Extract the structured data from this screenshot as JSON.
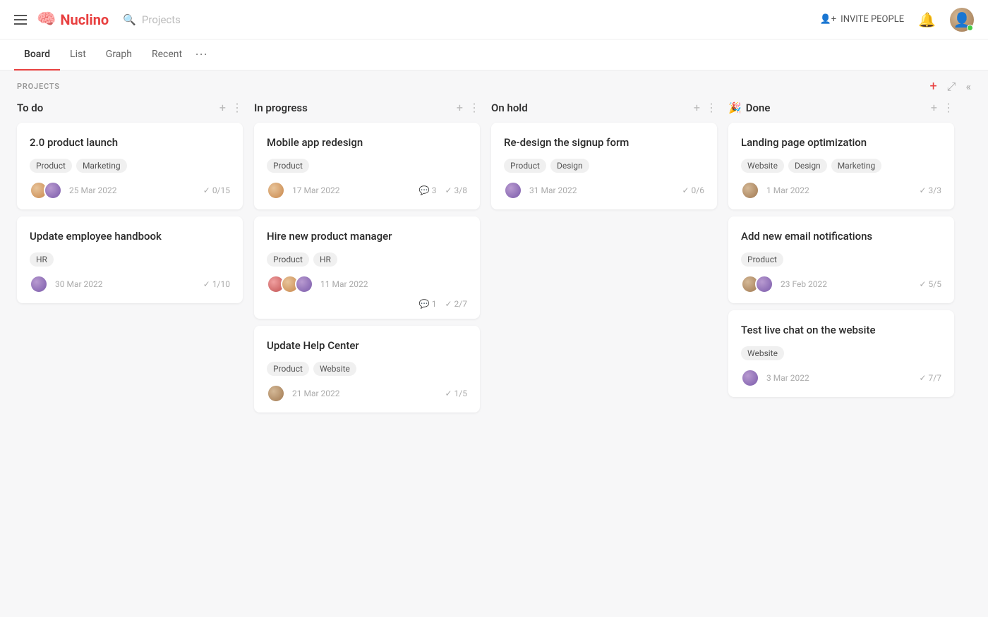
{
  "app": {
    "name": "Nuclino",
    "search_placeholder": "Projects"
  },
  "nav": {
    "invite_label": "INVITE PEOPLE",
    "tabs": [
      {
        "id": "board",
        "label": "Board",
        "active": true
      },
      {
        "id": "list",
        "label": "List",
        "active": false
      },
      {
        "id": "graph",
        "label": "Graph",
        "active": false
      },
      {
        "id": "recent",
        "label": "Recent",
        "active": false
      }
    ]
  },
  "board": {
    "section_label": "PROJECTS",
    "columns": [
      {
        "id": "todo",
        "title": "To do",
        "emoji": "",
        "cards": [
          {
            "id": "product-launch",
            "title": "2.0 product launch",
            "tags": [
              "Product",
              "Marketing"
            ],
            "date": "25 Mar 2022",
            "check": "0/15",
            "avatars": [
              "orange",
              "purple"
            ]
          },
          {
            "id": "employee-handbook",
            "title": "Update employee handbook",
            "tags": [
              "HR"
            ],
            "date": "30 Mar 2022",
            "check": "1/10",
            "avatars": [
              "purple"
            ]
          }
        ]
      },
      {
        "id": "in-progress",
        "title": "In progress",
        "emoji": "",
        "cards": [
          {
            "id": "mobile-redesign",
            "title": "Mobile app redesign",
            "tags": [
              "Product"
            ],
            "date": "17 Mar 2022",
            "comments": "3",
            "check": "3/8",
            "avatars": [
              "orange"
            ]
          },
          {
            "id": "hire-manager",
            "title": "Hire new product manager",
            "tags": [
              "Product",
              "HR"
            ],
            "date": "11 Mar 2022",
            "comments": "1",
            "check": "2/7",
            "avatars": [
              "red",
              "orange",
              "purple"
            ]
          },
          {
            "id": "help-center",
            "title": "Update Help Center",
            "tags": [
              "Product",
              "Website"
            ],
            "date": "21 Mar 2022",
            "check": "1/5",
            "avatars": [
              "tan"
            ]
          }
        ]
      },
      {
        "id": "on-hold",
        "title": "On hold",
        "emoji": "",
        "cards": [
          {
            "id": "signup-form",
            "title": "Re-design the signup form",
            "tags": [
              "Product",
              "Design"
            ],
            "date": "31 Mar 2022",
            "check": "0/6",
            "avatars": [
              "purple"
            ]
          }
        ]
      },
      {
        "id": "done",
        "title": "Done",
        "emoji": "🎉",
        "cards": [
          {
            "id": "landing-page",
            "title": "Landing page optimization",
            "tags": [
              "Website",
              "Design",
              "Marketing"
            ],
            "date": "1 Mar 2022",
            "check": "3/3",
            "avatars": [
              "tan"
            ]
          },
          {
            "id": "email-notif",
            "title": "Add new email notifications",
            "tags": [
              "Product"
            ],
            "date": "23 Feb 2022",
            "check": "5/5",
            "avatars": [
              "tan",
              "purple"
            ]
          },
          {
            "id": "live-chat",
            "title": "Test live chat on the website",
            "tags": [
              "Website"
            ],
            "date": "3 Mar 2022",
            "check": "7/7",
            "avatars": [
              "purple"
            ]
          }
        ]
      }
    ]
  }
}
